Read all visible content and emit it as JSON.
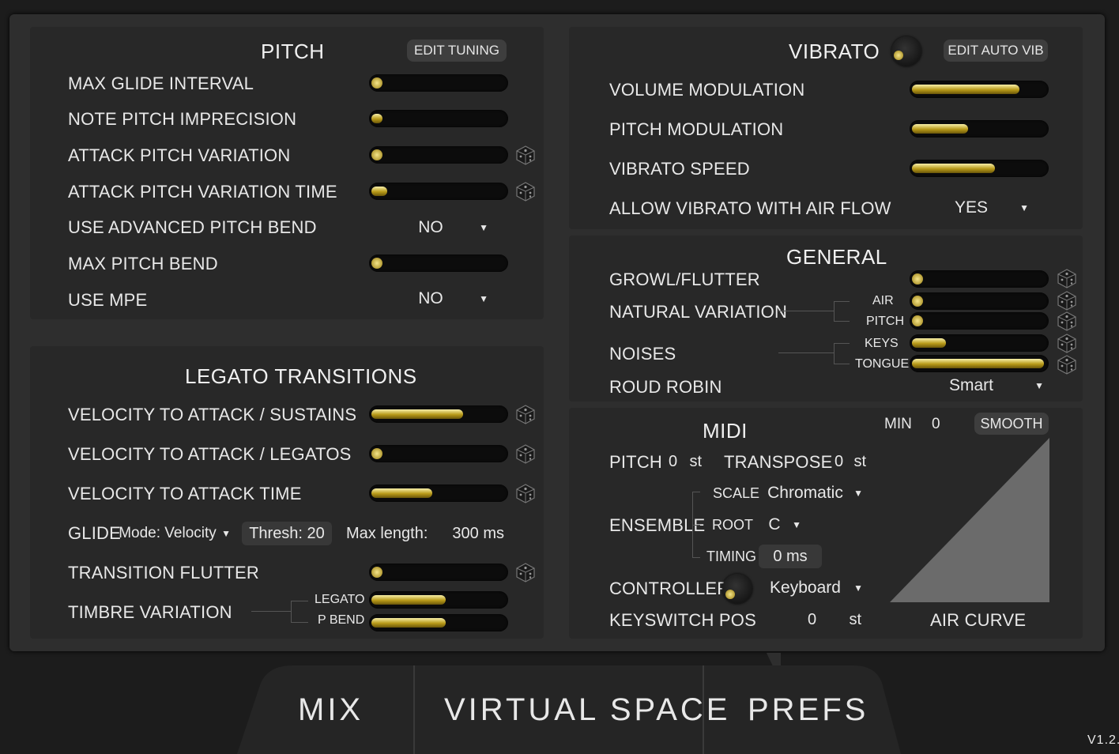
{
  "pitch": {
    "title": "PITCH",
    "edit_button": "EDIT TUNING",
    "rows": [
      {
        "label": "MAX GLIDE INTERVAL",
        "level": 0.0,
        "dice": false
      },
      {
        "label": "NOTE PITCH IMPRECISION",
        "level": 0.08,
        "dice": false
      },
      {
        "label": "ATTACK PITCH VARIATION",
        "level": 0.0,
        "dice": true
      },
      {
        "label": "ATTACK PITCH VARIATION TIME",
        "level": 0.12,
        "dice": true
      }
    ],
    "advanced_bend_label": "USE ADVANCED PITCH BEND",
    "advanced_bend_value": "NO",
    "max_bend_label": "MAX PITCH BEND",
    "max_bend_level": 0.0,
    "mpe_label": "USE MPE",
    "mpe_value": "NO"
  },
  "legato": {
    "title": "LEGATO TRANSITIONS",
    "rows": [
      {
        "label": "VELOCITY TO ATTACK / SUSTAINS",
        "level": 0.68
      },
      {
        "label": "VELOCITY TO ATTACK / LEGATOS",
        "level": 0.0
      },
      {
        "label": "VELOCITY TO ATTACK TIME",
        "level": 0.45
      }
    ],
    "glide_label": "GLIDE",
    "glide_mode": "Mode: Velocity",
    "thresh": "Thresh: 20",
    "max_length_label": "Max length:",
    "max_length_value": "300 ms",
    "flutter_label": "TRANSITION FLUTTER",
    "flutter_level": 0.0,
    "timbre_label": "TIMBRE VARIATION",
    "timbre_legato_label": "LEGATO",
    "timbre_legato_level": 0.55,
    "timbre_pbend_label": "P BEND",
    "timbre_pbend_level": 0.55
  },
  "vibrato": {
    "title": "VIBRATO",
    "edit_button": "EDIT AUTO VIB",
    "rows": [
      {
        "label": "VOLUME MODULATION",
        "level": 0.8
      },
      {
        "label": "PITCH MODULATION",
        "level": 0.42
      },
      {
        "label": "VIBRATO SPEED",
        "level": 0.62
      }
    ],
    "air_flow_label": "ALLOW VIBRATO WITH AIR FLOW",
    "air_flow_value": "YES"
  },
  "general": {
    "title": "GENERAL",
    "growl_label": "GROWL/FLUTTER",
    "growl_level": 0.0,
    "natural_label": "NATURAL VARIATION",
    "air_label": "AIR",
    "air_level": 0.0,
    "pitch_label": "PITCH",
    "pitch_level": 0.0,
    "noises_label": "NOISES",
    "keys_label": "KEYS",
    "keys_level": 0.25,
    "tongue_label": "TONGUE",
    "tongue_level": 0.98,
    "round_robin_label": "ROUD ROBIN",
    "round_robin_value": "Smart"
  },
  "midi": {
    "title": "MIDI",
    "pitch_label": "PITCH",
    "pitch_value": "0",
    "pitch_unit": "st",
    "transpose_label": "TRANSPOSE",
    "transpose_value": "0",
    "transpose_unit": "st",
    "ensemble_label": "ENSEMBLE",
    "scale_label": "SCALE",
    "scale_value": "Chromatic",
    "root_label": "ROOT",
    "root_value": "C",
    "timing_label": "TIMING",
    "timing_value": "0 ms",
    "controller_label": "CONTROLLER",
    "controller_value": "Keyboard",
    "keyswitch_label": "KEYSWITCH POS",
    "keyswitch_value": "0",
    "keyswitch_unit": "st",
    "min_label": "MIN",
    "min_value": "0",
    "smooth_button": "SMOOTH",
    "curve_label": "AIR CURVE"
  },
  "tabs": [
    "MIX",
    "VIRTUAL SPACE",
    "PREFS"
  ],
  "version": "V1.2."
}
